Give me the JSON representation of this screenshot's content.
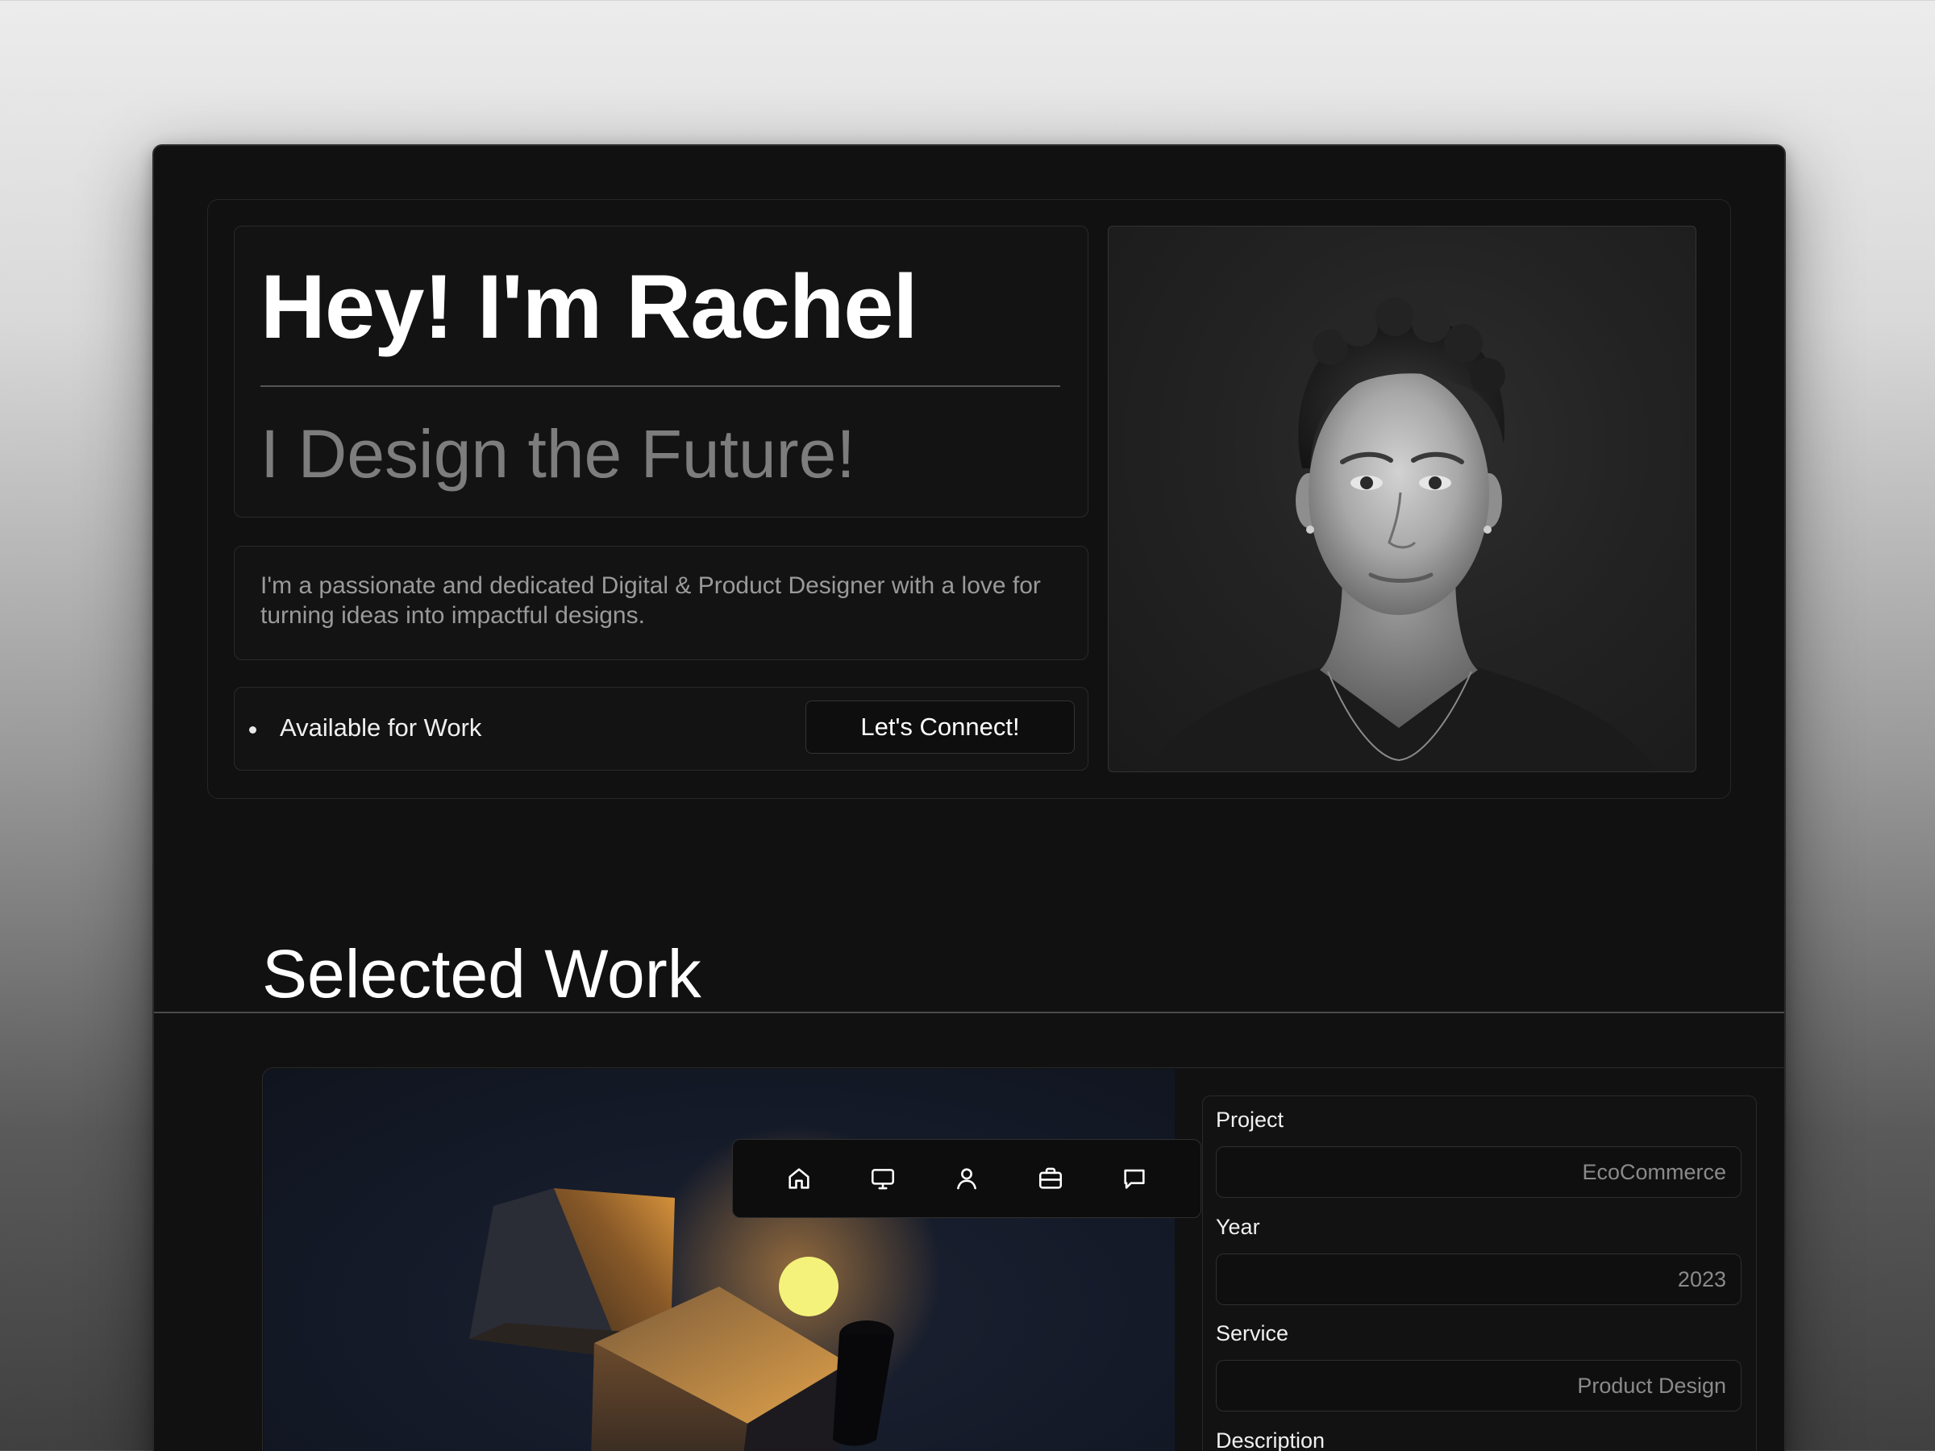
{
  "hero": {
    "title": "Hey! I'm Rachel",
    "subtitle": "I Design the Future!",
    "description": "I'm a passionate and dedicated Digital & Product Designer with a love for turning ideas into impactful designs.",
    "status": "Available for Work",
    "cta_label": "Let's Connect!",
    "photo_alt": "Portrait of Rachel"
  },
  "selected_work": {
    "title": "Selected Work",
    "image_alt": "EcoCommerce project artwork",
    "fields": [
      {
        "label": "Project",
        "value": "EcoCommerce"
      },
      {
        "label": "Year",
        "value": "2023"
      },
      {
        "label": "Service",
        "value": "Product Design"
      },
      {
        "label": "Description",
        "value": ""
      }
    ]
  },
  "nav": {
    "items": [
      {
        "icon": "home-icon",
        "label": "Home"
      },
      {
        "icon": "monitor-icon",
        "label": "Work"
      },
      {
        "icon": "user-icon",
        "label": "About"
      },
      {
        "icon": "briefcase-icon",
        "label": "Services"
      },
      {
        "icon": "message-icon",
        "label": "Contact"
      }
    ]
  },
  "colors": {
    "background": "#111111",
    "panel": "#131313",
    "text_primary": "#ffffff",
    "text_muted": "#7d7d7d",
    "accent_sun": "#f4f27a",
    "accent_glow": "#c87a2e"
  }
}
